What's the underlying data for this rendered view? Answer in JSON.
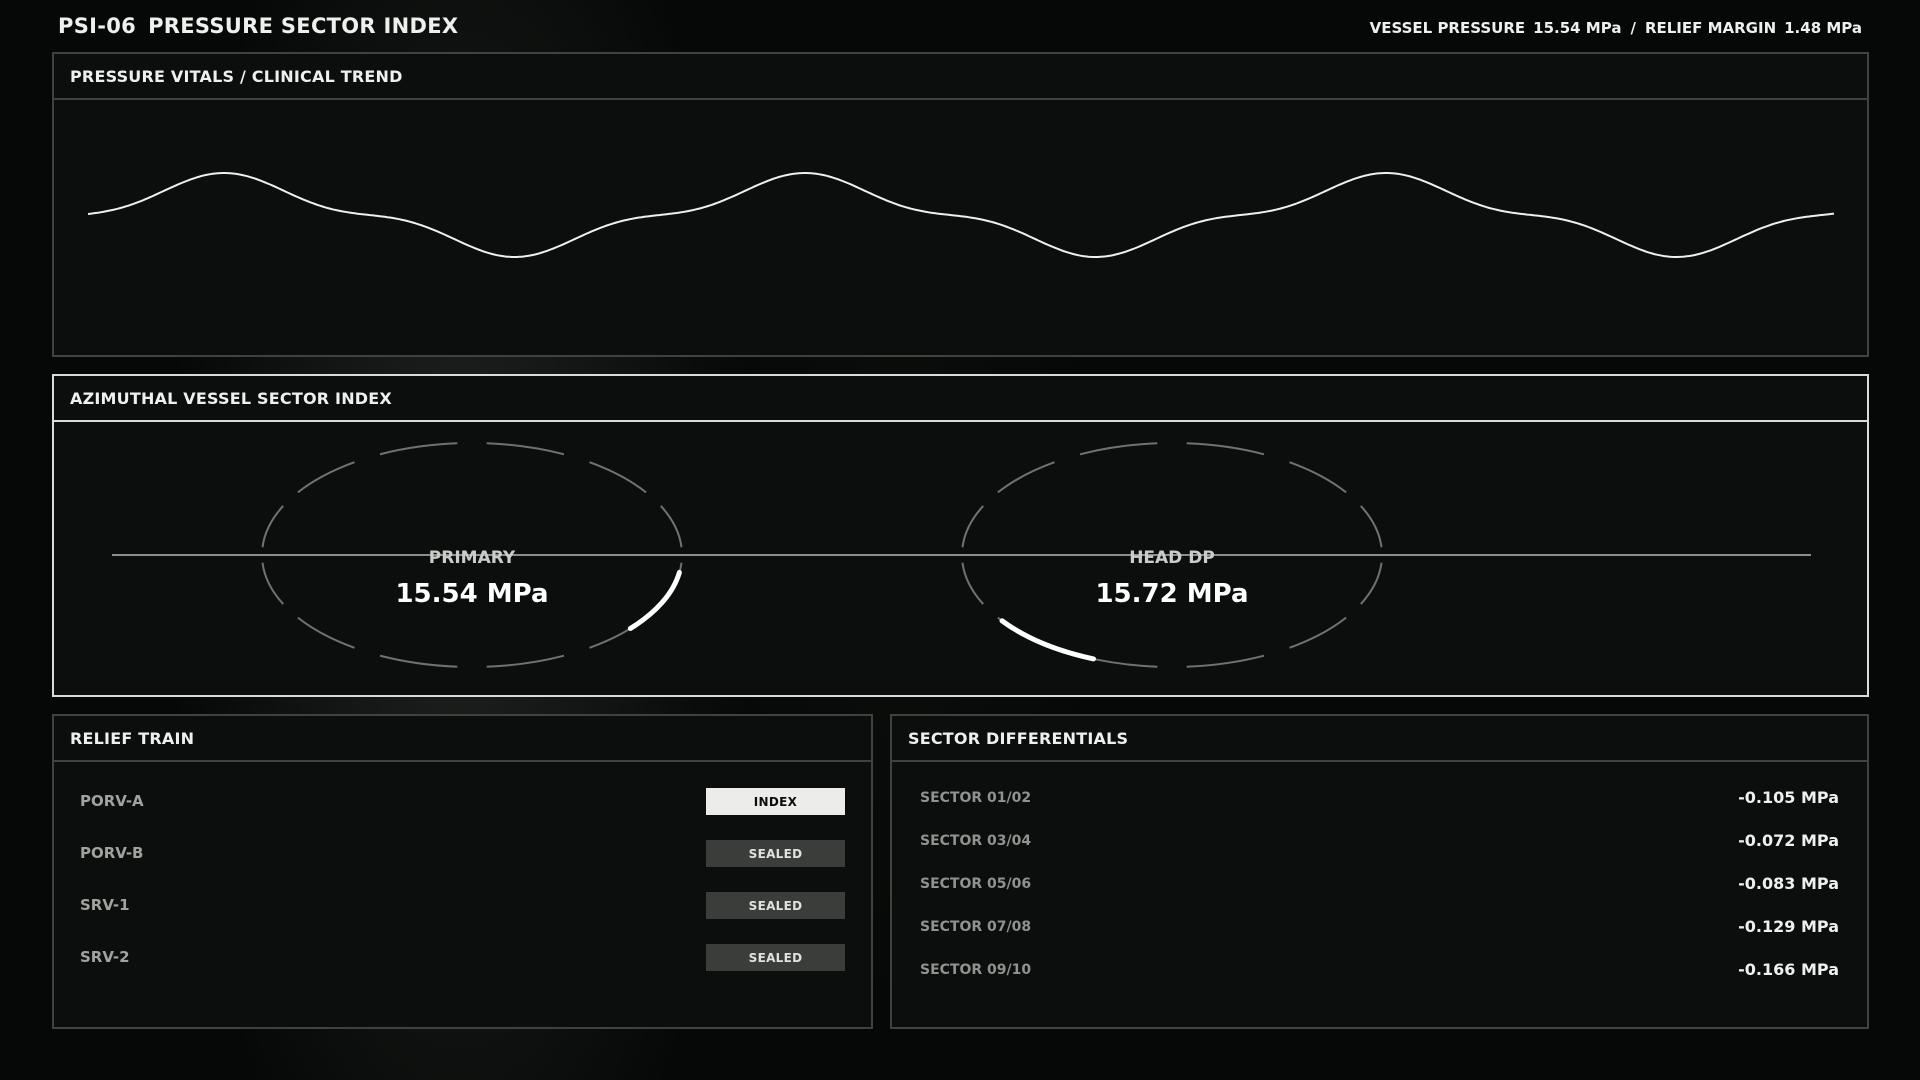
{
  "header": {
    "code": "PSI-06",
    "title": "PRESSURE SECTOR INDEX",
    "vessel_pressure_label": "VESSEL PRESSURE",
    "vessel_pressure_value": "15.54 MPa",
    "separator": "/",
    "relief_margin_label": "RELIEF MARGIN",
    "relief_margin_value": "1.48 MPa"
  },
  "trend": {
    "title": "PRESSURE VITALS / CLINICAL TREND"
  },
  "sector": {
    "title": "AZIMUTHAL VESSEL SECTOR INDEX",
    "gauges": [
      {
        "label": "PRIMARY",
        "value": "15.54 MPa",
        "marker_angle_deg": 25
      },
      {
        "label": "HEAD DP",
        "value": "15.72 MPa",
        "marker_angle_deg": 128
      }
    ]
  },
  "relief": {
    "title": "RELIEF TRAIN",
    "rows": [
      {
        "name": "PORV-A",
        "state": "INDEX",
        "active": true
      },
      {
        "name": "PORV-B",
        "state": "SEALED",
        "active": false
      },
      {
        "name": "SRV-1",
        "state": "SEALED",
        "active": false
      },
      {
        "name": "SRV-2",
        "state": "SEALED",
        "active": false
      }
    ]
  },
  "differentials": {
    "title": "SECTOR DIFFERENTIALS",
    "rows": [
      {
        "name": "SECTOR 01/02",
        "value": "-0.105 MPa"
      },
      {
        "name": "SECTOR 03/04",
        "value": "-0.072 MPa"
      },
      {
        "name": "SECTOR 05/06",
        "value": "-0.083 MPa"
      },
      {
        "name": "SECTOR 07/08",
        "value": "-0.129 MPa"
      },
      {
        "name": "SECTOR 09/10",
        "value": "-0.166 MPa"
      }
    ]
  },
  "colors": {
    "background": "#060807",
    "panel": "#0c0e0d",
    "border": "#3f433f",
    "border_bright": "#d8dbd7",
    "text": "#eef0ed",
    "text_dim": "#9fa39e",
    "badge_active": "#ecedeb",
    "badge_idle": "#3a3d3a"
  }
}
